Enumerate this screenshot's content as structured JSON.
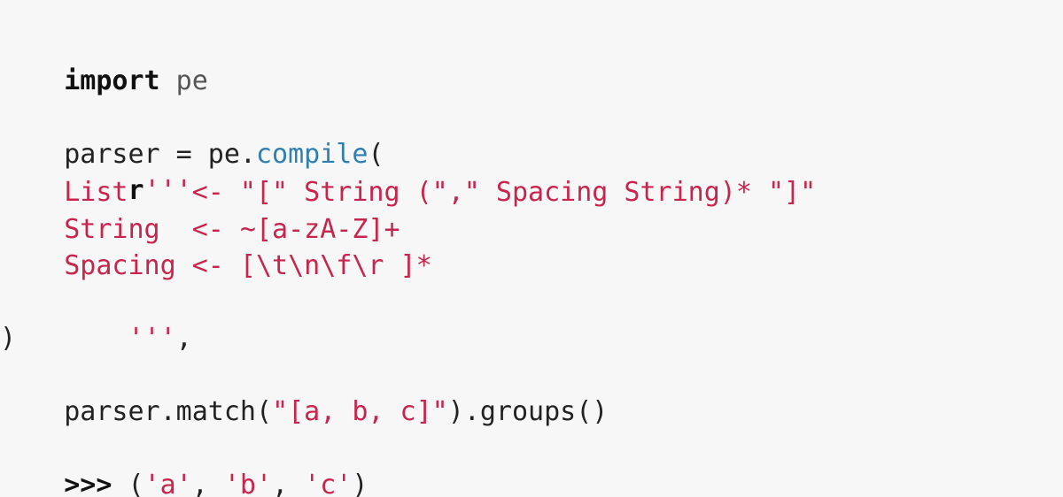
{
  "colors": {
    "background": "#f7f7f7",
    "text": "#222222",
    "keyword": "#111111",
    "module": "#555555",
    "function": "#2f7fb0",
    "string": "#c7254e"
  },
  "code": {
    "line1": {
      "keyword": "import",
      "module": " pe"
    },
    "line3": {
      "prefix": "parser = pe.",
      "func": "compile",
      "suffix": "("
    },
    "line4": {
      "indent": "    ",
      "raw_prefix": "r",
      "quote": "'''"
    },
    "line5": "    List    <- \"[\" String (\",\" Spacing String)* \"]\"",
    "line6": "    String  <- ~[a-zA-Z]+",
    "line7": "    Spacing <- [\\t\\n\\f\\r ]*",
    "line8": {
      "indent": "    ",
      "quote": "'''",
      "comma": ","
    },
    "line9": ")",
    "line10": {
      "prefix": "parser.match(",
      "arg": "\"[a, b, c]\"",
      "suffix": ").groups()"
    },
    "line12": {
      "prompt": ">>>",
      "open": " (",
      "a": "'a'",
      "sep1": ", ",
      "b": "'b'",
      "sep2": ", ",
      "c": "'c'",
      "close": ")"
    }
  }
}
